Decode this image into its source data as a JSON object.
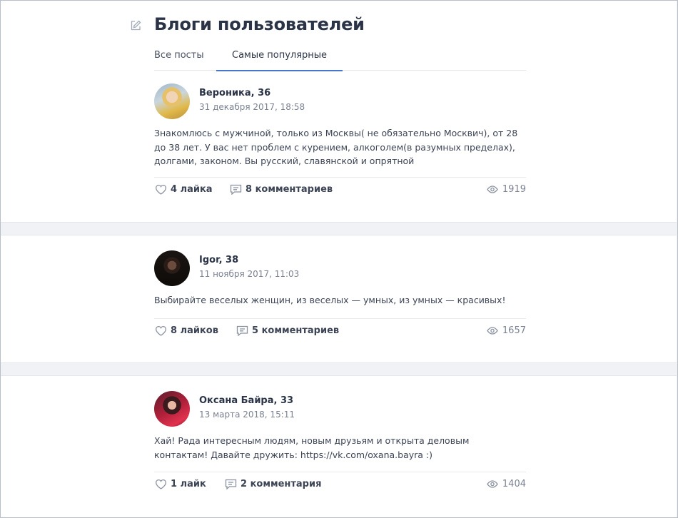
{
  "header": {
    "title": "Блоги пользователей",
    "tabs": [
      {
        "label": "Все посты",
        "active": false
      },
      {
        "label": "Самые популярные",
        "active": true
      }
    ]
  },
  "colors": {
    "accent": "#4a76c7",
    "background": "#f0f2f5",
    "card": "#ffffff"
  },
  "posts": [
    {
      "author": "Вероника, 36",
      "date": "31 декабря 2017, 18:58",
      "text": "Знакомлюсь с мужчиной, только из Москвы( не обязательно Москвич), от 28 до 38 лет. У вас нет проблем с курением, алкоголем(в разумных пределах), долгами, законом. Вы русский, славянской и опрятной",
      "likes": "4 лайка",
      "comments": "8 комментариев",
      "views": "1919"
    },
    {
      "author": "Igor, 38",
      "date": "11 ноября 2017, 11:03",
      "text": "Выбирайте веселых женщин, из веселых — умных, из умных — красивых!",
      "likes": "8 лайков",
      "comments": "5 комментариев",
      "views": "1657"
    },
    {
      "author": "Оксана Байра, 33",
      "date": "13 марта 2018, 15:11",
      "text": "Хай! Рада интересным людям, новым друзьям и открыта деловым контактам! Давайте дружить: https://vk.com/oxana.bayra :)",
      "likes": "1 лайк",
      "comments": "2 комментария",
      "views": "1404"
    }
  ],
  "icons": {
    "edit": "edit-icon",
    "like": "heart-icon",
    "comment": "comment-icon",
    "views": "eye-icon"
  }
}
